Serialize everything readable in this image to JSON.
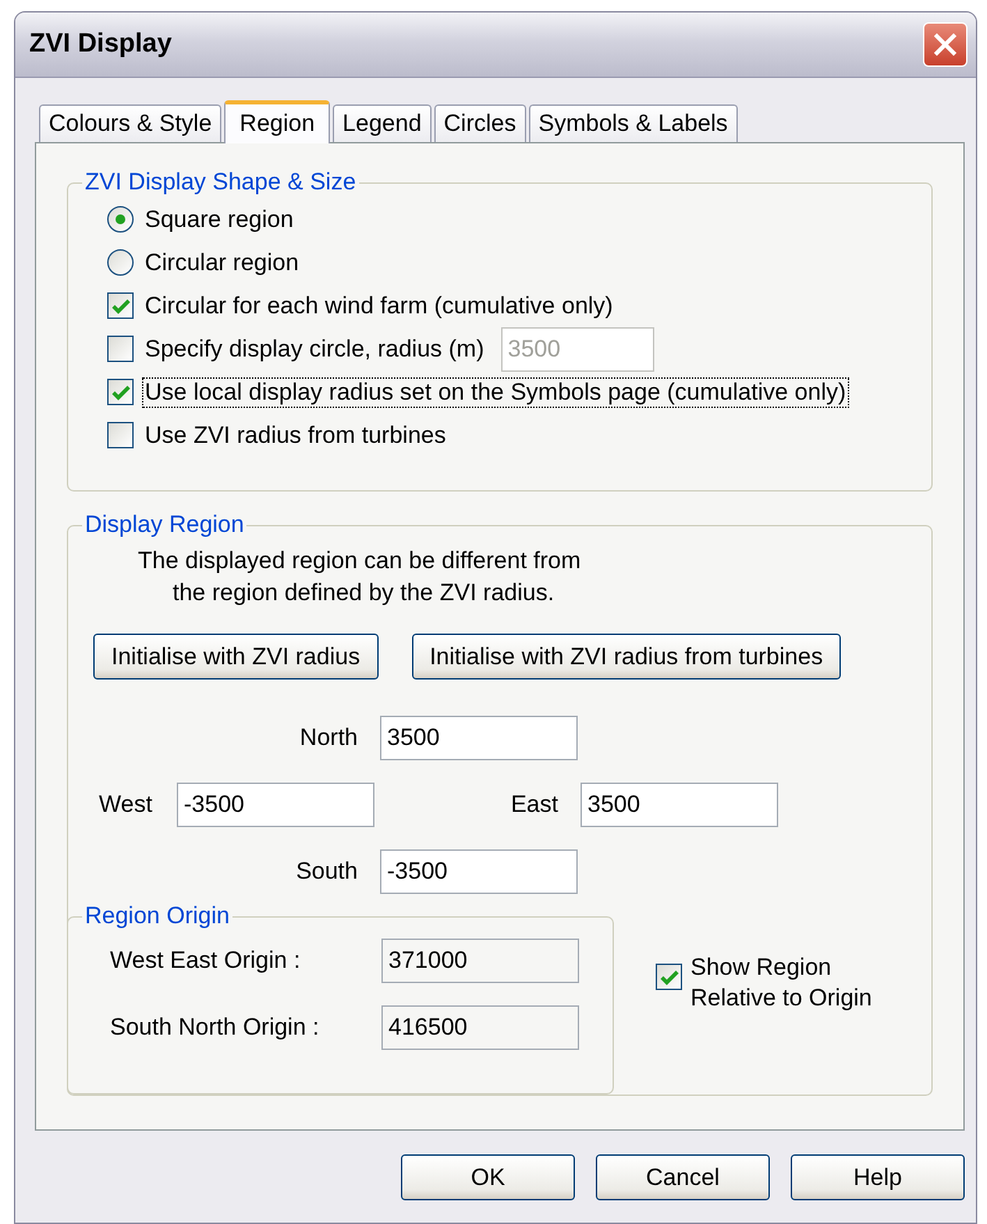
{
  "window": {
    "title": "ZVI Display"
  },
  "tabs": [
    {
      "label": "Colours & Style",
      "selected": false
    },
    {
      "label": "Region",
      "selected": true
    },
    {
      "label": "Legend",
      "selected": false
    },
    {
      "label": "Circles",
      "selected": false
    },
    {
      "label": "Symbols & Labels",
      "selected": false
    }
  ],
  "shape_group": {
    "title": "ZVI Display Shape & Size",
    "options": [
      {
        "kind": "radio",
        "label": "Square region",
        "checked": true,
        "focused": false
      },
      {
        "kind": "radio",
        "label": "Circular region",
        "checked": false,
        "focused": false
      },
      {
        "kind": "checkbox",
        "label": "Circular for each wind farm (cumulative only)",
        "checked": true,
        "focused": false
      },
      {
        "kind": "checkbox",
        "label": "Specify display circle, radius (m)",
        "checked": false,
        "focused": false,
        "field": {
          "value": "3500",
          "disabled": true
        }
      },
      {
        "kind": "checkbox",
        "label": "Use local display radius set on the Symbols page (cumulative only)",
        "checked": true,
        "focused": true
      },
      {
        "kind": "checkbox",
        "label": "Use ZVI radius from turbines",
        "checked": false,
        "focused": false
      }
    ]
  },
  "display_region": {
    "title": "Display Region",
    "note_lines": [
      "The displayed region can be different from",
      "the region defined by the ZVI radius."
    ],
    "buttons": [
      "Initialise with ZVI radius",
      "Initialise with ZVI radius from turbines"
    ],
    "north": {
      "label": "North",
      "value": "3500"
    },
    "west": {
      "label": "West",
      "value": "-3500"
    },
    "east": {
      "label": "East",
      "value": "3500"
    },
    "south": {
      "label": "South",
      "value": "-3500"
    },
    "origin": {
      "title": "Region Origin",
      "rows": [
        {
          "label": "West East Origin :",
          "value": "371000"
        },
        {
          "label": "South North Origin :",
          "value": "416500"
        }
      ]
    },
    "relative": {
      "label": "Show Region Relative to Origin",
      "checked": true
    }
  },
  "footer_buttons": [
    "OK",
    "Cancel",
    "Help"
  ]
}
